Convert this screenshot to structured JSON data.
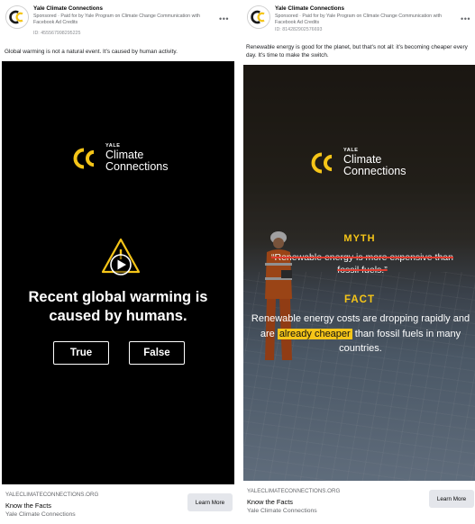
{
  "colors": {
    "brand_yellow": "#f5c518",
    "strike_red": "#e23b2e",
    "cta_bg": "#e4e6eb",
    "muted_text": "#65676b"
  },
  "brand": {
    "yale": "YALE",
    "line1": "Climate",
    "line2": "Connections"
  },
  "ads": [
    {
      "page_name": "Yale Climate Connections",
      "sponsored": "Sponsored · Paid for by Yale Program on Climate Change Communication with Facebook Ad Credits",
      "ad_id": "ID: 455567998295225",
      "more_icon": "more-horizontal-icon",
      "body_text": "Global warming is not a natural event. It's caused by human activity.",
      "creative": {
        "icon": "warning-play-icon",
        "question": "Recent global warming is caused by humans.",
        "buttons": [
          "True",
          "False"
        ]
      },
      "footer": {
        "domain": "YALECLIMATECONNECTIONS.ORG",
        "headline": "Know the Facts",
        "sub": "Yale Climate Connections",
        "cta": "Learn More"
      }
    },
    {
      "page_name": "Yale Climate Connections",
      "sponsored": "Sponsored · Paid for by Yale Program on Climate Change Communication with Facebook Ad Credits",
      "ad_id": "ID: 814282902576693",
      "more_icon": "more-horizontal-icon",
      "body_text": "Renewable energy is good for the planet, but that's not all: it's becoming cheaper every day. It's time to make the switch.",
      "creative": {
        "myth_label": "MYTH",
        "myth_text": "“Renewable energy is more expensive than fossil fuels.”",
        "fact_label": "FACT",
        "fact_before": "Renewable energy costs are dropping rapidly and are ",
        "fact_highlight": "already cheaper",
        "fact_after": " than fossil fuels in many countries."
      },
      "footer": {
        "domain": "YALECLIMATECONNECTIONS.ORG",
        "headline": "Know the Facts",
        "sub": "Yale Climate Connections",
        "cta": "Learn More"
      }
    }
  ]
}
